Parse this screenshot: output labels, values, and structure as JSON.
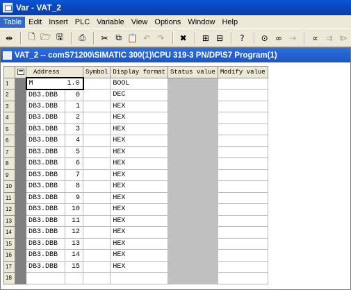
{
  "window": {
    "title": "Var - VAT_2"
  },
  "menubar": {
    "items": [
      {
        "label": "Table",
        "active": true
      },
      {
        "label": "Edit"
      },
      {
        "label": "Insert"
      },
      {
        "label": "PLC"
      },
      {
        "label": "Variable"
      },
      {
        "label": "View"
      },
      {
        "label": "Options"
      },
      {
        "label": "Window"
      },
      {
        "label": "Help"
      }
    ]
  },
  "toolbar": {
    "buttons": [
      {
        "name": "pin-icon",
        "glyph": "⇹"
      },
      {
        "sep": true
      },
      {
        "name": "new-icon",
        "glyph": "🗋"
      },
      {
        "name": "open-icon",
        "glyph": "🗁"
      },
      {
        "name": "save-icon",
        "glyph": "🖫"
      },
      {
        "sep": true
      },
      {
        "name": "print-icon",
        "glyph": "⎙"
      },
      {
        "sep": true
      },
      {
        "name": "cut-icon",
        "glyph": "✂"
      },
      {
        "name": "copy-icon",
        "glyph": "⧉"
      },
      {
        "name": "paste-icon",
        "glyph": "📋"
      },
      {
        "name": "undo-icon",
        "glyph": "↶",
        "disabled": true
      },
      {
        "name": "redo-icon",
        "glyph": "↷",
        "disabled": true
      },
      {
        "sep": true
      },
      {
        "name": "delete-icon",
        "glyph": "✖"
      },
      {
        "sep": true
      },
      {
        "name": "accessible-nodes-icon",
        "glyph": "⊞"
      },
      {
        "name": "monitor-icon",
        "glyph": "⊟"
      },
      {
        "sep": true
      },
      {
        "name": "help-icon",
        "glyph": "?"
      },
      {
        "sep": true
      },
      {
        "name": "monitor-variable-icon",
        "glyph": "⊙"
      },
      {
        "name": "modify-variable-icon",
        "glyph": "∞"
      },
      {
        "name": "update-monitor-icon",
        "glyph": "⇢",
        "disabled": true
      },
      {
        "sep": true
      },
      {
        "name": "activate-modify-icon",
        "glyph": "∝"
      },
      {
        "name": "force-icon",
        "glyph": "⇉",
        "disabled": true
      },
      {
        "name": "enable-peripheral-icon",
        "glyph": "⧐",
        "disabled": true
      }
    ]
  },
  "child_window": {
    "title": "VAT_2 -- comS71200\\SIMATIC 300(1)\\CPU 319-3 PN/DP\\S7 Program(1)"
  },
  "table": {
    "headers": {
      "address": "Address",
      "symbol": "Symbol",
      "display_format": "Display format",
      "status_value": "Status value",
      "modify_value": "Modify value"
    },
    "rows": [
      {
        "num": "1",
        "op": "M",
        "addr": "1.0",
        "format": "BOOL",
        "selected": true
      },
      {
        "num": "2",
        "op": "DB3.DBB",
        "addr": "0",
        "format": "DEC"
      },
      {
        "num": "3",
        "op": "DB3.DBB",
        "addr": "1",
        "format": "HEX"
      },
      {
        "num": "4",
        "op": "DB3.DBB",
        "addr": "2",
        "format": "HEX"
      },
      {
        "num": "5",
        "op": "DB3.DBB",
        "addr": "3",
        "format": "HEX"
      },
      {
        "num": "6",
        "op": "DB3.DBB",
        "addr": "4",
        "format": "HEX"
      },
      {
        "num": "7",
        "op": "DB3.DBB",
        "addr": "5",
        "format": "HEX"
      },
      {
        "num": "8",
        "op": "DB3.DBB",
        "addr": "6",
        "format": "HEX"
      },
      {
        "num": "9",
        "op": "DB3.DBB",
        "addr": "7",
        "format": "HEX"
      },
      {
        "num": "10",
        "op": "DB3.DBB",
        "addr": "8",
        "format": "HEX"
      },
      {
        "num": "11",
        "op": "DB3.DBB",
        "addr": "9",
        "format": "HEX"
      },
      {
        "num": "12",
        "op": "DB3.DBB",
        "addr": "10",
        "format": "HEX"
      },
      {
        "num": "13",
        "op": "DB3.DBB",
        "addr": "11",
        "format": "HEX"
      },
      {
        "num": "14",
        "op": "DB3.DBB",
        "addr": "12",
        "format": "HEX"
      },
      {
        "num": "15",
        "op": "DB3.DBB",
        "addr": "13",
        "format": "HEX"
      },
      {
        "num": "16",
        "op": "DB3.DBB",
        "addr": "14",
        "format": "HEX"
      },
      {
        "num": "17",
        "op": "DB3.DBB",
        "addr": "15",
        "format": "HEX"
      },
      {
        "num": "18",
        "op": "",
        "addr": "",
        "format": ""
      }
    ]
  }
}
